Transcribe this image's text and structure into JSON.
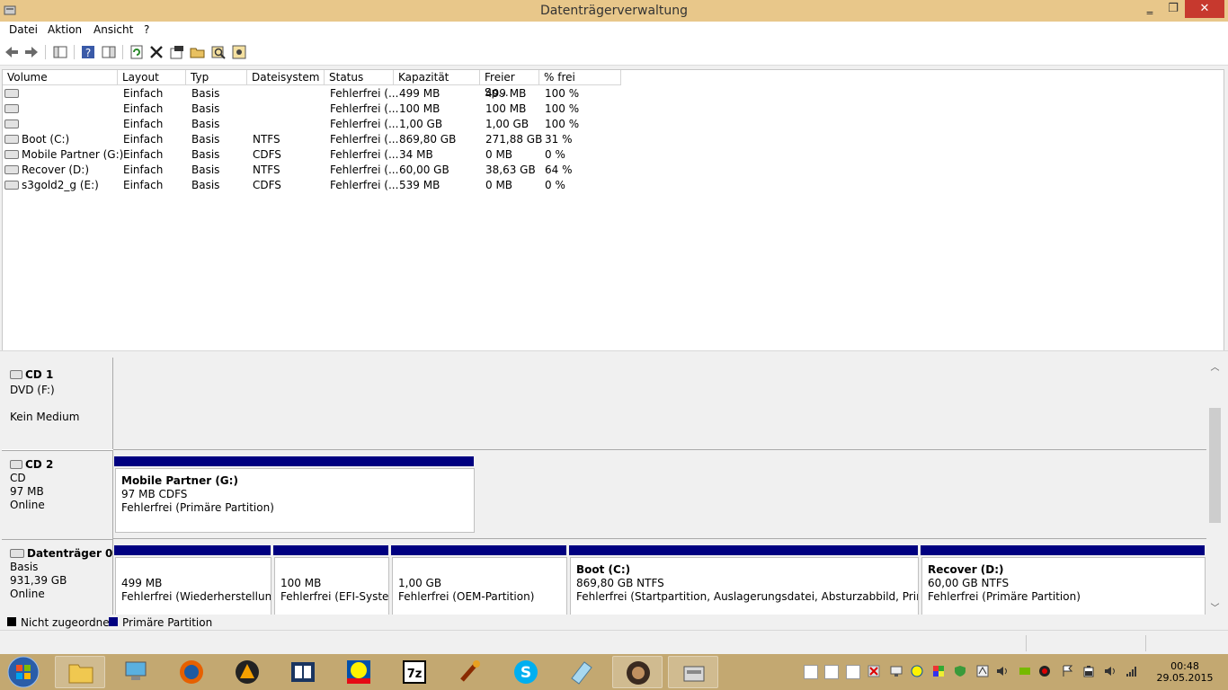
{
  "window": {
    "title": "Datenträgerverwaltung",
    "controls": {
      "minimize": "‗",
      "maximize": "❐",
      "close": "✕"
    }
  },
  "menu": [
    "Datei",
    "Aktion",
    "Ansicht",
    "?"
  ],
  "volume_list": {
    "columns": [
      "Volume",
      "Layout",
      "Typ",
      "Dateisystem",
      "Status",
      "Kapazität",
      "Freier Sp...",
      "% frei"
    ],
    "rows": [
      [
        "",
        "Einfach",
        "Basis",
        "",
        "Fehlerfrei (...",
        "499 MB",
        "499 MB",
        "100 %"
      ],
      [
        "",
        "Einfach",
        "Basis",
        "",
        "Fehlerfrei (...",
        "100 MB",
        "100 MB",
        "100 %"
      ],
      [
        "",
        "Einfach",
        "Basis",
        "",
        "Fehlerfrei (...",
        "1,00 GB",
        "1,00 GB",
        "100 %"
      ],
      [
        "Boot (C:)",
        "Einfach",
        "Basis",
        "NTFS",
        "Fehlerfrei (...",
        "869,80 GB",
        "271,88 GB",
        "31 %"
      ],
      [
        "Mobile Partner (G:)",
        "Einfach",
        "Basis",
        "CDFS",
        "Fehlerfrei (...",
        "34 MB",
        "0 MB",
        "0 %"
      ],
      [
        "Recover (D:)",
        "Einfach",
        "Basis",
        "NTFS",
        "Fehlerfrei (...",
        "60,00 GB",
        "38,63 GB",
        "64 %"
      ],
      [
        "s3gold2_g (E:)",
        "Einfach",
        "Basis",
        "CDFS",
        "Fehlerfrei (...",
        "539 MB",
        "0 MB",
        "0 %"
      ]
    ]
  },
  "disks": {
    "cd1": {
      "name": "CD 1",
      "line1": "DVD (F:)",
      "line2": "Kein Medium"
    },
    "cd2": {
      "name": "CD 2",
      "line1": "CD",
      "line2": "97 MB",
      "line3": "Online",
      "partition": {
        "title": "Mobile Partner  (G:)",
        "size": "97 MB CDFS",
        "status": "Fehlerfrei (Primäre Partition)"
      }
    },
    "disk0": {
      "name": "Datenträger 0",
      "line1": "Basis",
      "line2": "931,39 GB",
      "line3": "Online",
      "partitions": [
        {
          "title": "",
          "size": "499 MB",
          "status": "Fehlerfrei (Wiederherstellungsp"
        },
        {
          "title": "",
          "size": "100 MB",
          "status": "Fehlerfrei (EFI-System"
        },
        {
          "title": "",
          "size": "1,00 GB",
          "status": "Fehlerfrei (OEM-Partition)"
        },
        {
          "title": "Boot  (C:)",
          "size": "869,80 GB NTFS",
          "status": "Fehlerfrei (Startpartition, Auslagerungsdatei, Absturzabbild, Primäre Par"
        },
        {
          "title": "Recover  (D:)",
          "size": "60,00 GB NTFS",
          "status": "Fehlerfrei (Primäre Partition)"
        }
      ]
    }
  },
  "legend": {
    "unallocated": "Nicht zugeordnet",
    "primary": "Primäre Partition"
  },
  "clock": {
    "time": "00:48",
    "date": "29.05.2015"
  },
  "colors": {
    "titlebar": "#e8c78a",
    "partition_bar": "#000080",
    "close_button": "#c7392e",
    "taskbar": "#c3a871"
  }
}
